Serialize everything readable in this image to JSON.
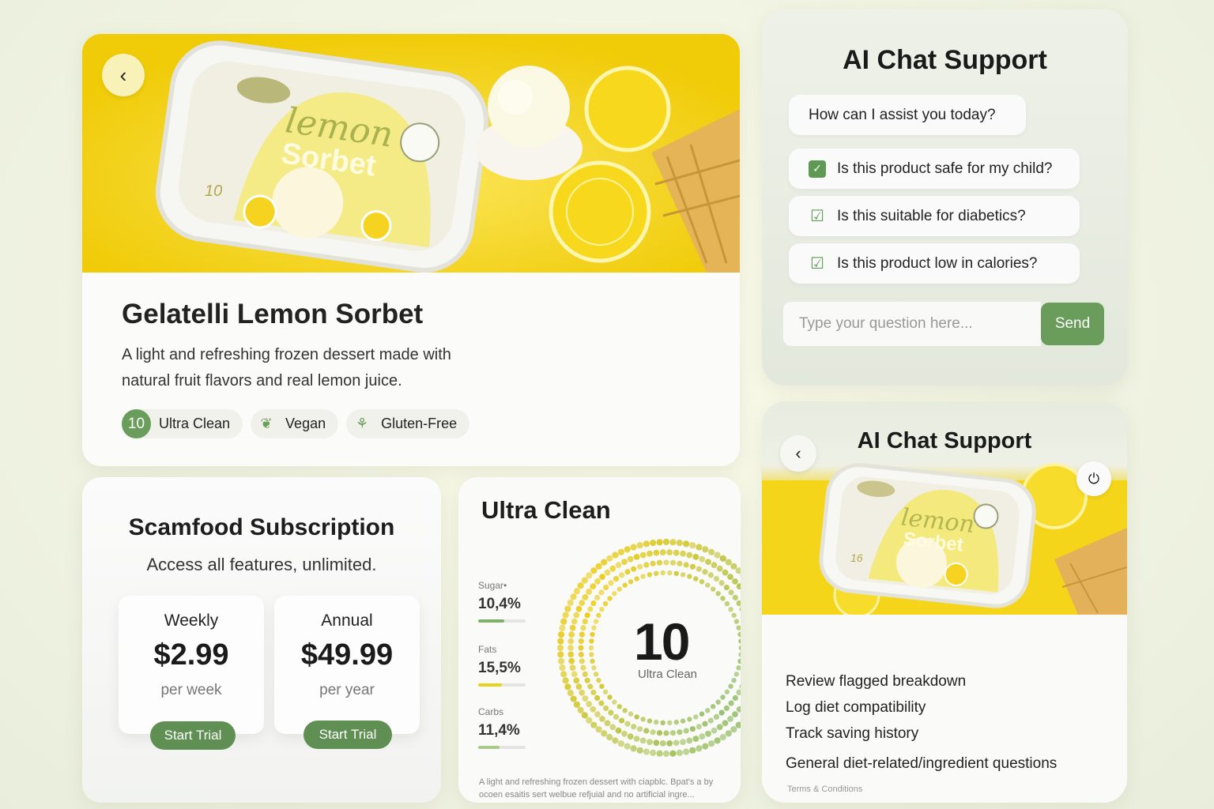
{
  "product": {
    "title": "Gelatelli Lemon Sorbet",
    "description": "A light and refreshing frozen dessert made with natural fruit flavors and real lemon juice.",
    "tags": [
      {
        "badge": "10",
        "label": "Ultra Clean"
      },
      {
        "icon": "leaf-icon",
        "label": "Vegan"
      },
      {
        "icon": "wheat-icon",
        "label": "Gluten-Free"
      }
    ],
    "package": {
      "script": "lemon",
      "name": "Sorbet",
      "number": "10"
    }
  },
  "chat_top": {
    "title": "AI Chat Support",
    "greeting": "How can I assist you today?",
    "options": [
      "Is this product safe for my child?",
      "Is this suitable for diabetics?",
      "Is this product low in calories?"
    ],
    "input_placeholder": "Type your question here...",
    "send_label": "Send"
  },
  "subscription": {
    "title": "Scamfood Subscription",
    "subtitle": "Access all features, unlimited.",
    "plans": [
      {
        "name": "Weekly",
        "price": "$2.99",
        "period": "per week",
        "cta": "Start Trial"
      },
      {
        "name": "Annual",
        "price": "$49.99",
        "period": "per year",
        "cta": "Start Trial"
      }
    ]
  },
  "ultra_clean": {
    "title": "Ultra Clean",
    "stats": [
      {
        "label": "Sugar•",
        "value": "10,4%",
        "level": 0.55,
        "color": "#7fb069"
      },
      {
        "label": "Fats",
        "value": "15,5%",
        "level": 0.5,
        "color": "#e8d21c"
      },
      {
        "label": "Carbs",
        "value": "11,4%",
        "level": 0.45,
        "color": "#a7c98a"
      }
    ],
    "score": "10",
    "score_label": "Ultra Clean",
    "footer": "A light and refreshing frozen dessert with ciapblc. Bpat's a by ocoen esaitis sert welbue refjuial and no artificial ingre..."
  },
  "chat_bottom": {
    "title": "AI Chat Support",
    "package": {
      "script": "lemon",
      "name": "Sorbet",
      "number": "16"
    },
    "features": [
      "Review flagged breakdown",
      "Log diet compatibility",
      "Track saving history",
      "General diet-related/ingredient questions"
    ],
    "terms": "Terms & Conditions"
  },
  "colors": {
    "accent_green": "#6a9c5b",
    "lemon_yellow": "#f4d41a"
  }
}
